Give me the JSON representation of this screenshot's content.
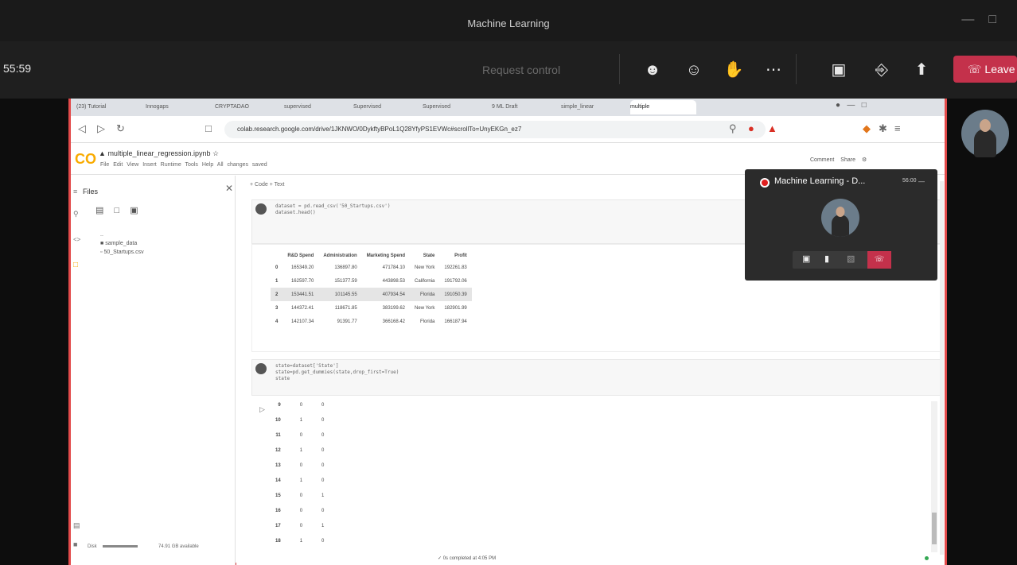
{
  "teams": {
    "window_title": "Machine Learning",
    "timer": "55:59",
    "request_control": "Request control",
    "leave_label": "Leave",
    "toolbar_icons": [
      "people-icon",
      "chat-icon",
      "reactions-icon",
      "more-icon",
      "camera-off-icon",
      "mic-off-icon",
      "share-icon"
    ]
  },
  "browser": {
    "tabs": [
      "(23) Tutorial",
      "Innogaps",
      "CRYPTADAO",
      "supervised",
      "Supervised",
      "Supervised",
      "9 ML Draft",
      "simple_linear",
      "multiple"
    ],
    "url": "colab.research.google.com/drive/1JKNWO/0DykftyBPoL1Q28YfyPS1EVWc#scrollTo=UnyEKGn_ez7"
  },
  "colab": {
    "logo": "CO",
    "notebook_title": "multiple_linear_regression.ipynb",
    "menu": "File  Edit  View  Insert  Runtime  Tools  Help  All changes saved",
    "comment_label": "Comment",
    "share_label": "Share",
    "add_cells": "+ Code   + Text",
    "sidebar_title": "Files",
    "file_tree": [
      "..",
      "sample_data",
      "50_Startups.csv"
    ],
    "disk_label": "Disk",
    "disk_available": "74.91 GB available",
    "status": "✓ 0s   completed at 4:05 PM"
  },
  "cells": {
    "cell1_code": "dataset = pd.read_csv('50_Startups.csv')\ndataset.head()",
    "cell2_code": "state=dataset['State']\nstate=pd.get_dummies(state,drop_first=True)\nstate"
  },
  "df_head": {
    "columns": [
      "",
      "R&D Spend",
      "Administration",
      "Marketing Spend",
      "State",
      "Profit"
    ],
    "rows": [
      [
        "0",
        "165349.20",
        "136897.80",
        "471784.10",
        "New York",
        "192261.83"
      ],
      [
        "1",
        "162597.70",
        "151377.59",
        "443898.53",
        "California",
        "191792.06"
      ],
      [
        "2",
        "153441.51",
        "101145.55",
        "407934.54",
        "Florida",
        "191050.39"
      ],
      [
        "3",
        "144372.41",
        "118671.85",
        "383199.62",
        "New York",
        "182901.99"
      ],
      [
        "4",
        "142107.34",
        "91391.77",
        "366168.42",
        "Florida",
        "166187.94"
      ]
    ]
  },
  "dummies": {
    "rows": [
      [
        "9",
        "0",
        "0"
      ],
      [
        "10",
        "1",
        "0"
      ],
      [
        "11",
        "0",
        "0"
      ],
      [
        "12",
        "1",
        "0"
      ],
      [
        "13",
        "0",
        "0"
      ],
      [
        "14",
        "1",
        "0"
      ],
      [
        "15",
        "0",
        "1"
      ],
      [
        "16",
        "0",
        "0"
      ],
      [
        "17",
        "0",
        "1"
      ],
      [
        "18",
        "1",
        "0"
      ]
    ]
  },
  "meeting_overlay": {
    "title": "Machine Learning - D...",
    "time": "56:00"
  }
}
